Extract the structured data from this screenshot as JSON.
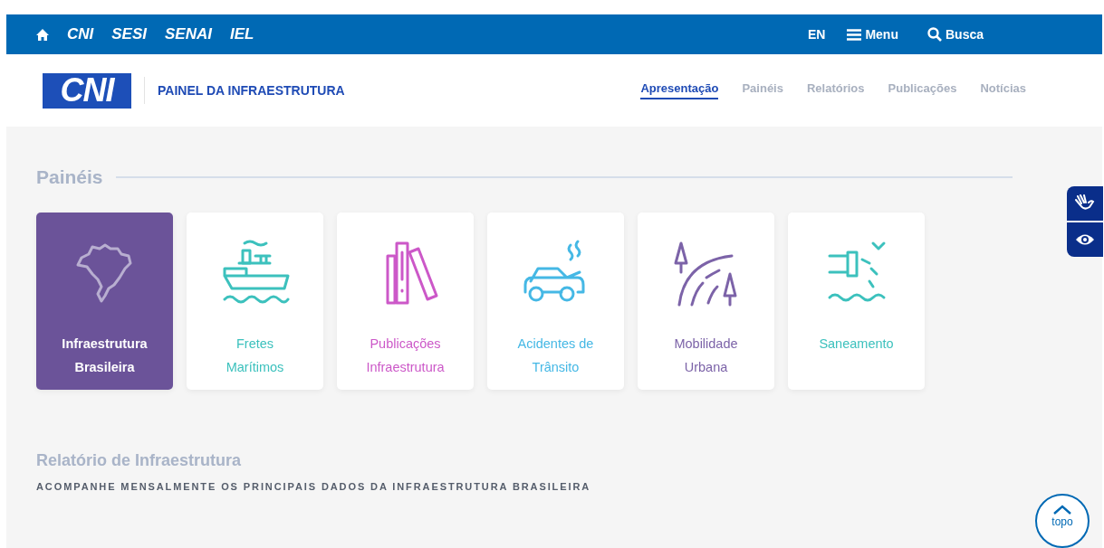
{
  "top_bar": {
    "links": [
      "CNI",
      "SESI",
      "SENAI",
      "IEL"
    ],
    "language": "EN",
    "menu": "Menu",
    "search": "Busca"
  },
  "header": {
    "logo": "CNI",
    "title": "PAINEL DA INFRAESTRUTURA",
    "nav": [
      {
        "label": "Apresentação",
        "selected": true
      },
      {
        "label": "Painéis",
        "selected": false
      },
      {
        "label": "Relatórios",
        "selected": false
      },
      {
        "label": "Publicações",
        "selected": false
      },
      {
        "label": "Notícias",
        "selected": false
      }
    ]
  },
  "panels": {
    "heading": "Painéis",
    "cards": [
      {
        "kind": "map",
        "lines": [
          "Infraestrutura",
          "Brasileira"
        ],
        "color": "#6b5399",
        "selected": true
      },
      {
        "kind": "ship",
        "lines": [
          "Fretes",
          "Marítimos"
        ],
        "color": "#3cc1bd",
        "selected": false
      },
      {
        "kind": "books",
        "lines": [
          "Publicações",
          "Infraestrutura"
        ],
        "color": "#cc58c8",
        "selected": false
      },
      {
        "kind": "car",
        "lines": [
          "Acidentes de",
          "Trânsito"
        ],
        "color": "#45b8e5",
        "selected": false
      },
      {
        "kind": "road",
        "lines": [
          "Mobilidade",
          "Urbana"
        ],
        "color": "#7c63a8",
        "selected": false
      },
      {
        "kind": "sanitation",
        "lines": [
          "Saneamento"
        ],
        "color": "#3cc1bd",
        "selected": false
      }
    ]
  },
  "report": {
    "title": "Relatório de Infraestrutura",
    "subtitle": "ACOMPANHE MENSALMENTE OS PRINCIPAIS DADOS DA INFRAESTRUTURA BRASILEIRA"
  },
  "back_to_top": "topo"
}
